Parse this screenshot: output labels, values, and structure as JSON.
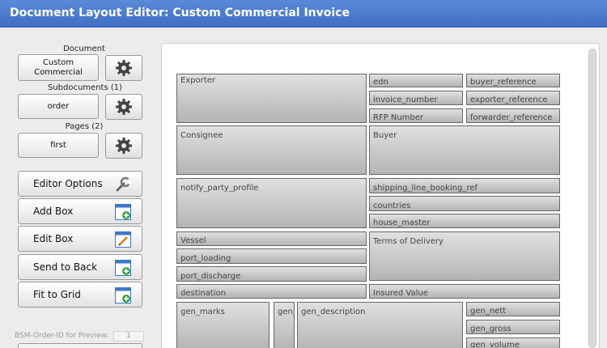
{
  "window": {
    "title": "Document Layout Editor: Custom Commercial Invoice"
  },
  "sidebar": {
    "document_label": "Document",
    "document_value": "Custom Commercial",
    "subdocuments_label": "Subdocuments (1)",
    "subdocuments_value": "order",
    "pages_label": "Pages (2)",
    "pages_value": "first",
    "actions": [
      {
        "label": "Editor Options",
        "icon": "wrench-icon"
      },
      {
        "label": "Add Box",
        "icon": "add-window-icon"
      },
      {
        "label": "Edit Box",
        "icon": "edit-window-icon"
      },
      {
        "label": "Send to Back",
        "icon": "send-back-icon"
      },
      {
        "label": "Fit to Grid",
        "icon": "fit-grid-icon"
      }
    ],
    "preview_label": "BSM-Order-ID for Preview:",
    "preview_value": "1"
  },
  "canvas": {
    "boxes": [
      "Exporter",
      "edn",
      "buyer_reference",
      "invoice_number",
      "exporter_reference",
      "RFP Number",
      "forwarder_reference",
      "Consignee",
      "Buyer",
      "notify_party_profile",
      "shipping_line_booking_ref",
      "countries",
      "house_master",
      "Vessel",
      "Terms of Delivery",
      "port_loading",
      "port_discharge",
      "destination",
      "Insured Value",
      "gen_marks",
      "gen_",
      "gen_description",
      "gen_nett",
      "gen_gross",
      "gen_volume"
    ]
  },
  "colors": {
    "titlebar": "#4a7bcf",
    "accent_green": "#3aa13a",
    "box_border": "#666666"
  }
}
